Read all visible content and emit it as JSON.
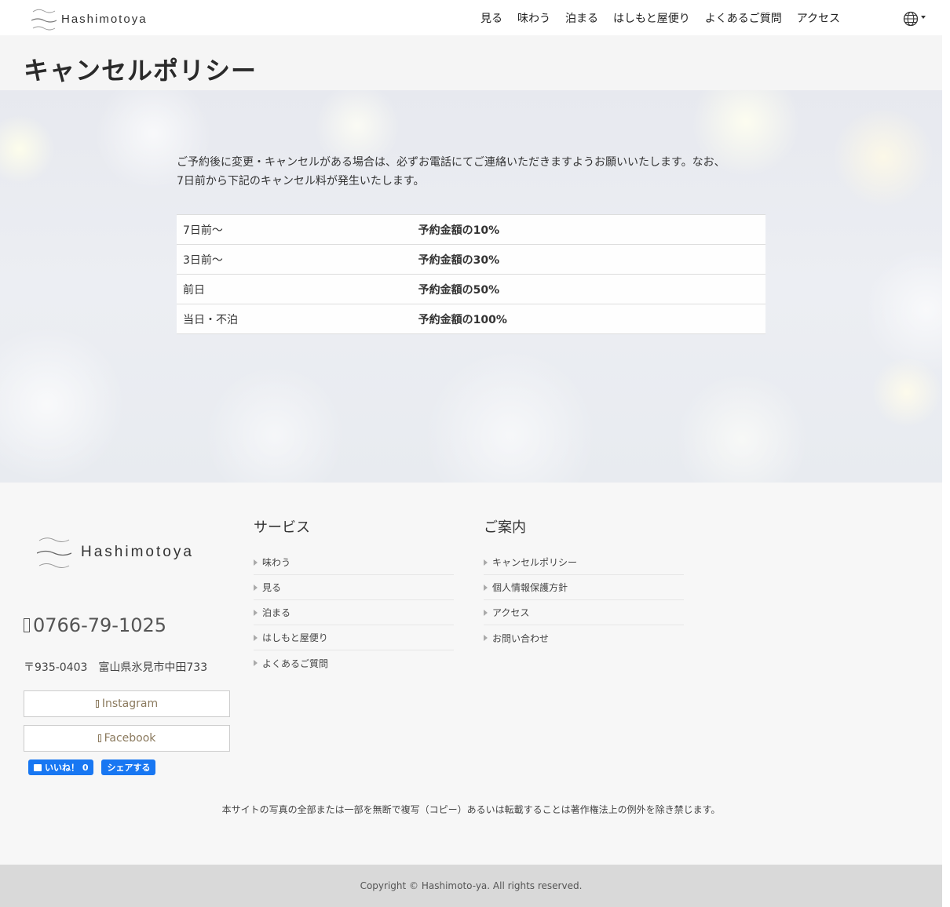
{
  "header": {
    "logo_text": "Hashimotoya",
    "nav": [
      "見る",
      "味わう",
      "泊まる",
      "はしもと屋便り",
      "よくあるご質問",
      "アクセス"
    ],
    "lang_icon": "globe-icon"
  },
  "title": "キャンセルポリシー",
  "content": {
    "intro_line1": "ご予約後に変更・キャンセルがある場合は、必ずお電話にてご連絡いただきますようお願いいたします。なお、",
    "intro_line2": "7日前から下記のキャンセル料が発生いたします。",
    "policy": [
      {
        "when": "7日前〜",
        "fee": "予約金額の10%"
      },
      {
        "when": "3日前〜",
        "fee": "予約金額の30%"
      },
      {
        "when": "前日",
        "fee": "予約金額の50%"
      },
      {
        "when": "当日・不泊",
        "fee": "予約金額の100%"
      }
    ]
  },
  "footer": {
    "logo_text": "Hashimotoya",
    "phone": "0766-79-1025",
    "address": "〒935-0403　富山県氷見市中田733",
    "instagram_label": "Instagram",
    "facebook_label": "Facebook",
    "fb_like": "いいね！ 0",
    "fb_share": "シェアする",
    "services_title": "サービス",
    "services": [
      "味わう",
      "見る",
      "泊まる",
      "はしもと屋便り",
      "よくあるご質問"
    ],
    "info_title": "ご案内",
    "info": [
      "キャンセルポリシー",
      "個人情報保護方針",
      "アクセス",
      "お問い合わせ"
    ],
    "notice": "本サイトの写真の全部または一部を無断で複写（コピー）あるいは転載することは著作権法上の例外を除き禁じます。",
    "copyright": "Copyright © Hashimoto-ya. All rights reserved."
  },
  "colors": {
    "accent_brown": "#8b7a5e",
    "facebook_blue": "#1877f2"
  }
}
